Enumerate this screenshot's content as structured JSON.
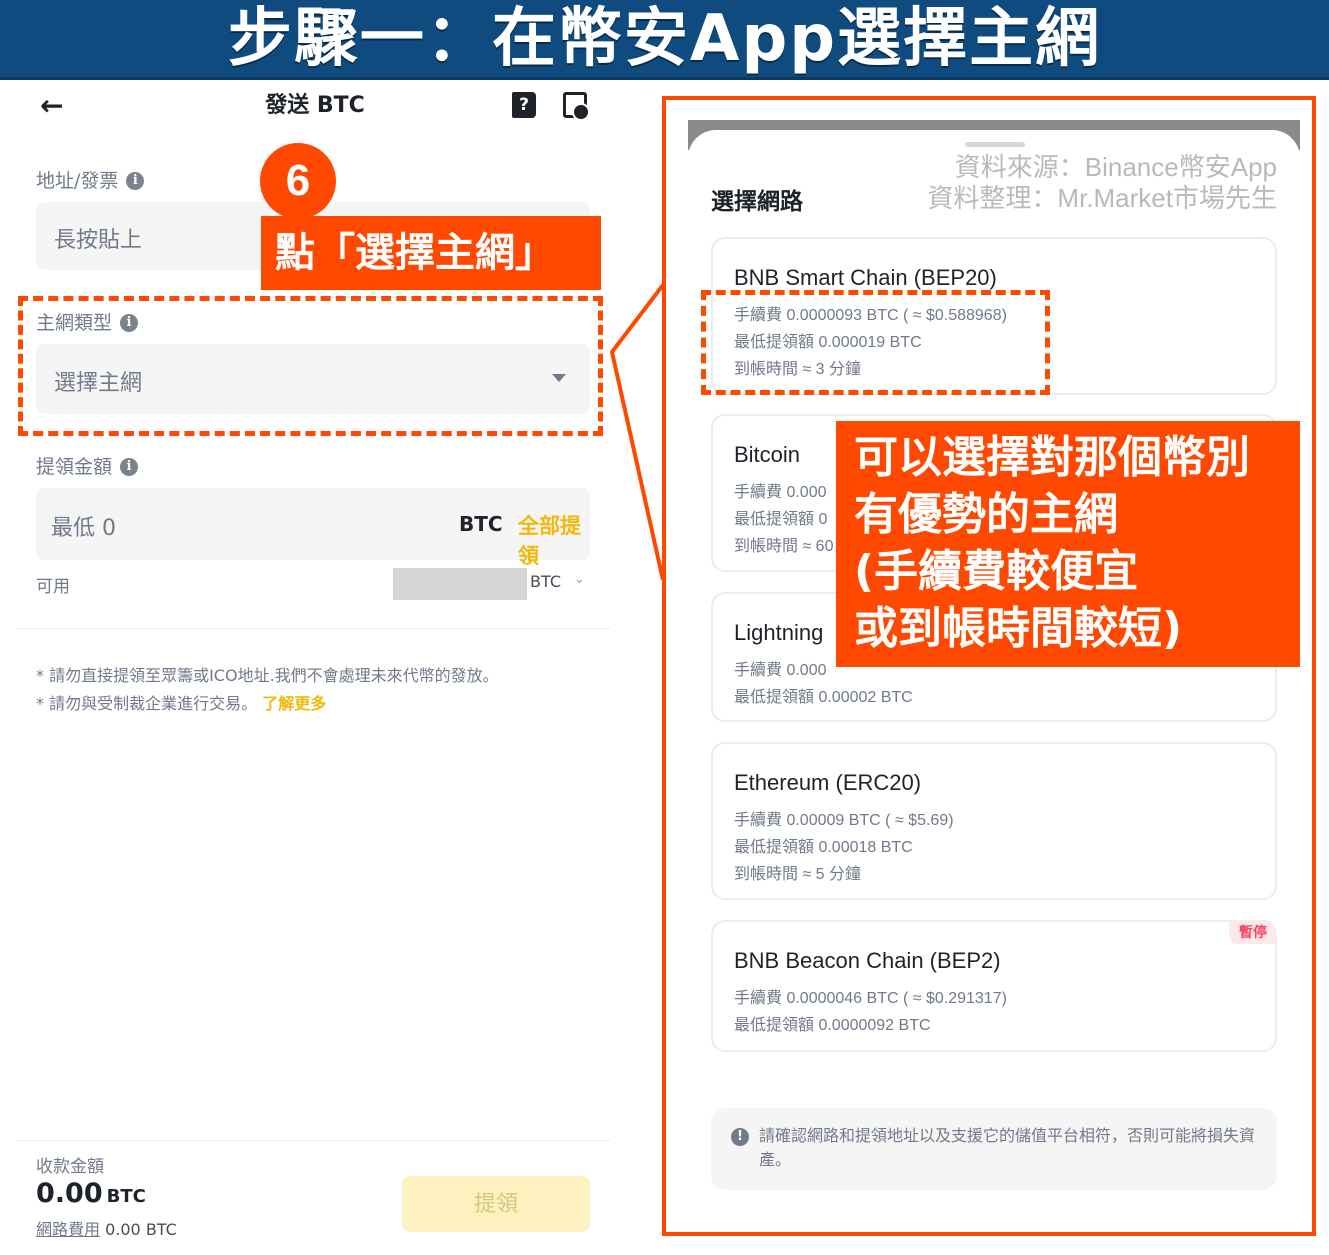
{
  "banner": {
    "title": "步驟一：在幣安App選擇主網"
  },
  "header": {
    "title": "發送 BTC",
    "book_glyph": "?"
  },
  "address": {
    "label": "地址/發票",
    "placeholder": "長按貼上"
  },
  "network": {
    "label": "主網類型",
    "placeholder": "選擇主網"
  },
  "amount": {
    "label": "提領金額",
    "placeholder": "最低 0",
    "unit": "BTC",
    "withdraw_all": "全部提領"
  },
  "available": {
    "label": "可用",
    "unit": "BTC"
  },
  "notes": {
    "line1": "* 請勿直接提領至眾籌或ICO地址.我們不會處理未來代幣的發放。",
    "line2": "* 請勿與受制裁企業進行交易。",
    "learn_more": "了解更多"
  },
  "footer": {
    "receive_label": "收款金額",
    "receive_amount": "0.00",
    "receive_unit": "BTC",
    "fee_label": "網路費用",
    "fee_value": "0.00 BTC",
    "withdraw_button": "提領"
  },
  "annotations": {
    "step_number": "6",
    "step_callout": "點「選擇主網」",
    "network_callout_lines": [
      "可以選擇對那個幣別",
      "有優勢的主網",
      "(手續費較便宜",
      "或到帳時間較短)"
    ],
    "accent_color": "#ff4800"
  },
  "sheet": {
    "title": "選擇網路",
    "source_line1": "資料來源：Binance幣安App",
    "source_line2": "資料整理：Mr.Market市場先生",
    "networks": [
      {
        "name": "BNB Smart Chain (BEP20)",
        "fee": "手續費 0.0000093 BTC ( ≈ $0.588968)",
        "min": "最低提領額 0.000019 BTC",
        "time": "到帳時間 ≈ 3 分鐘"
      },
      {
        "name": "Bitcoin",
        "fee": "手續費 0.000",
        "min": "最低提領額 0",
        "time": "到帳時間 ≈ 60"
      },
      {
        "name": "Lightning",
        "fee": "手續費 0.000",
        "min": "最低提領額 0.00002 BTC"
      },
      {
        "name": "Ethereum (ERC20)",
        "fee": "手續費 0.00009 BTC ( ≈ $5.69)",
        "min": "最低提領額 0.00018 BTC",
        "time": "到帳時間 ≈ 5 分鐘"
      },
      {
        "name": "BNB Beacon Chain (BEP2)",
        "fee": "手續費 0.0000046 BTC ( ≈ $0.291317)",
        "min": "最低提領額 0.0000092 BTC",
        "badge": "暫停"
      }
    ],
    "warning": "請確認網路和提領地址以及支援它的儲值平台相符，否則可能將損失資產。"
  },
  "colors": {
    "banner": "#0f4b7e",
    "binance_yellow": "#f0b90b",
    "pause_red": "#f6465d"
  }
}
